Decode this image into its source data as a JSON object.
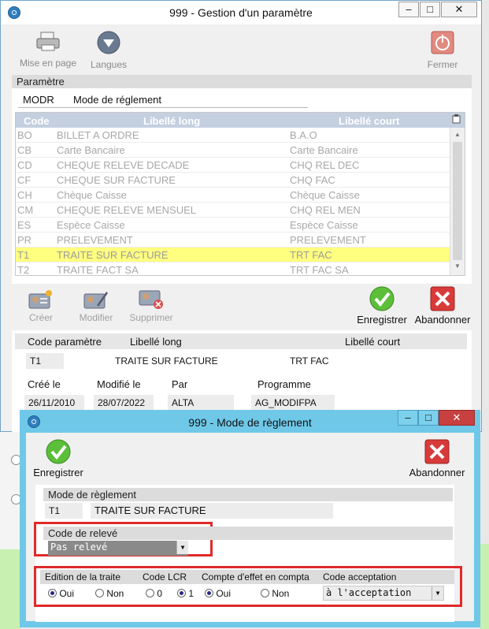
{
  "main_window": {
    "title": "999 - Gestion d'un paramètre",
    "controls": {
      "minimize": "–",
      "maximize": "□",
      "close": "✕"
    },
    "toolbar": {
      "print_label": "Mise en page",
      "languages_label": "Langues",
      "close_label": "Fermer"
    },
    "param_section": {
      "heading": "Paramètre",
      "code": "MODR",
      "label": "Mode de réglement"
    },
    "grid": {
      "columns": {
        "code": "Code",
        "long": "Libellé long",
        "short": "Libellé court"
      },
      "rows": [
        {
          "code": "BO",
          "long": "BILLET A ORDRE",
          "short": "B.A.O"
        },
        {
          "code": "CB",
          "long": "Carte Bancaire",
          "short": "Carte Bancaire"
        },
        {
          "code": "CD",
          "long": "CHEQUE RELEVE DECADE",
          "short": "CHQ REL DEC"
        },
        {
          "code": "CF",
          "long": "CHEQUE SUR FACTURE",
          "short": "CHQ FAC"
        },
        {
          "code": "CH",
          "long": "Chèque Caisse",
          "short": "Chèque Caisse"
        },
        {
          "code": "CM",
          "long": "CHEQUE RELEVE MENSUEL",
          "short": "CHQ REL MEN"
        },
        {
          "code": "ES",
          "long": "Espèce Caisse",
          "short": "Espèce Caisse"
        },
        {
          "code": "PR",
          "long": "PRELEVEMENT",
          "short": "PRELEVEMENT"
        },
        {
          "code": "T1",
          "long": "TRAITE  SUR FACTURE",
          "short": "TRT  FAC"
        },
        {
          "code": "T2",
          "long": "TRAITE FACT SA",
          "short": "TRT FAC SA"
        }
      ],
      "selected_index": 8
    },
    "actions": {
      "create": "Créer",
      "modify": "Modifier",
      "delete": "Supprimer",
      "save": "Enregistrer",
      "cancel": "Abandonner"
    },
    "detail": {
      "code_label": "Code paramètre",
      "long_label": "Libellé long",
      "short_label": "Libellé court",
      "code": "T1",
      "long": "TRAITE  SUR FACTURE",
      "short": "TRT  FAC",
      "created_label": "Créé le",
      "modified_label": "Modifié le",
      "by_label": "Par",
      "program_label": "Programme",
      "created": "26/11/2010",
      "modified": "28/07/2022",
      "by": "ALTA",
      "program": "AG_MODIFPA"
    }
  },
  "dialog": {
    "title": "999 - Mode de règlement",
    "controls": {
      "minimize": "–",
      "maximize": "□",
      "close": "✕"
    },
    "save_label": "Enregistrer",
    "cancel_label": "Abandonner",
    "mode_heading": "Mode de règlement",
    "mode_code": "T1",
    "mode_label": "TRAITE  SUR FACTURE",
    "releve_heading": "Code de relevé",
    "releve_value": "Pas relevé",
    "edition_label": "Edition de la traite",
    "lcr_label": "Code LCR",
    "compte_label": "Compte d'effet en compta",
    "acceptation_label": "Code acceptation",
    "edition_options": [
      "Oui",
      "Non"
    ],
    "edition_selected": "Oui",
    "lcr_options": [
      "0",
      "1"
    ],
    "lcr_selected": "1",
    "compte_options": [
      "Oui",
      "Non"
    ],
    "compte_selected": "Oui",
    "acceptation_value": "à l'acceptation"
  },
  "colors": {
    "highlight_row": "#ffff80",
    "grid_header": "#c4cfe0",
    "dialog_frame": "#6fc8e8",
    "annotation_red": "#e02a2a"
  }
}
